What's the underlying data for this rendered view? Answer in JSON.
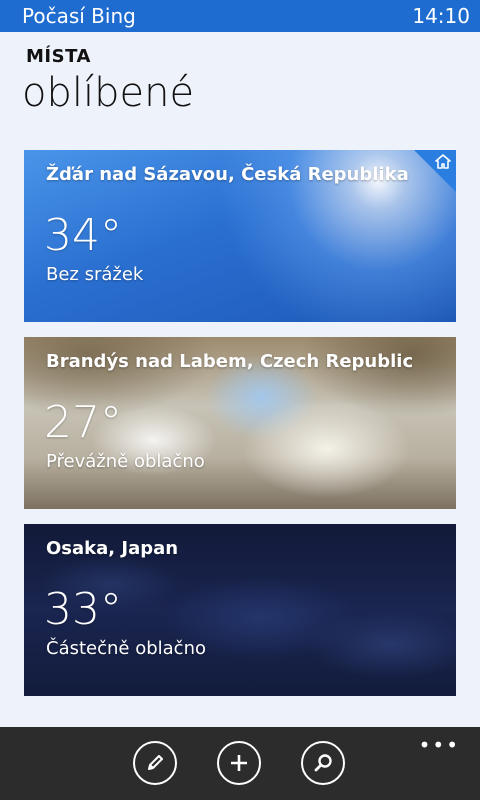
{
  "status_bar": {
    "app_title": "Počasí Bing",
    "clock": "14:10"
  },
  "pivot": {
    "section": "MÍSTA",
    "title": "oblíbené"
  },
  "tiles": [
    {
      "city": "Žďár nad Sázavou, Česká Republika",
      "temp": "34°",
      "condition": "Bez srážek",
      "home": true
    },
    {
      "city": "Brandýs nad Labem, Czech Republic",
      "temp": "27°",
      "condition": "Převážně oblačno"
    },
    {
      "city": "Osaka, Japan",
      "temp": "33°",
      "condition": "Částečně oblačno"
    }
  ],
  "app_bar": {
    "buttons": [
      {
        "icon": "edit-icon"
      },
      {
        "icon": "add-icon"
      },
      {
        "icon": "search-icon"
      }
    ],
    "more": "•••"
  }
}
